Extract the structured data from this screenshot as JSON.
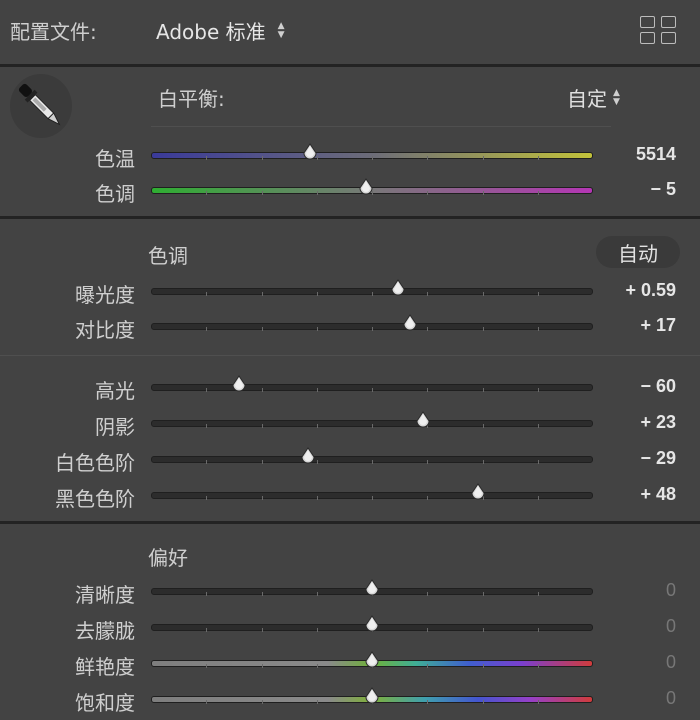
{
  "header": {
    "profile_label": "配置文件:",
    "profile_value": "Adobe 标准",
    "grid_icon": "grid-view-icon"
  },
  "white_balance": {
    "label": "白平衡:",
    "mode": "自定",
    "eyedropper_icon": "eyedropper-icon",
    "sliders": [
      {
        "name": "temperature",
        "label": "色温",
        "value": "5514",
        "position": 0.36,
        "track": "temp"
      },
      {
        "name": "tint",
        "label": "色调",
        "value": "− 5",
        "position": 0.487,
        "track": "tint"
      }
    ]
  },
  "tone": {
    "title": "色调",
    "auto_label": "自动",
    "sliders": [
      {
        "name": "exposure",
        "label": "曝光度",
        "value": "+ 0.59",
        "position": 0.559
      },
      {
        "name": "contrast",
        "label": "对比度",
        "value": "+ 17",
        "position": 0.585
      },
      {
        "name": "highlights",
        "label": "高光",
        "value": "− 60",
        "position": 0.2
      },
      {
        "name": "shadows",
        "label": "阴影",
        "value": "+ 23",
        "position": 0.615
      },
      {
        "name": "whites",
        "label": "白色色阶",
        "value": "− 29",
        "position": 0.355
      },
      {
        "name": "blacks",
        "label": "黑色色阶",
        "value": "+ 48",
        "position": 0.74
      }
    ]
  },
  "presence": {
    "title": "偏好",
    "sliders": [
      {
        "name": "clarity",
        "label": "清晰度",
        "value": "0",
        "position": 0.5
      },
      {
        "name": "dehaze",
        "label": "去朦胧",
        "value": "0",
        "position": 0.5
      },
      {
        "name": "vibrance",
        "label": "鲜艳度",
        "value": "0",
        "position": 0.5,
        "track": "vib"
      },
      {
        "name": "saturation",
        "label": "饱和度",
        "value": "0",
        "position": 0.5,
        "track": "sat"
      }
    ]
  }
}
